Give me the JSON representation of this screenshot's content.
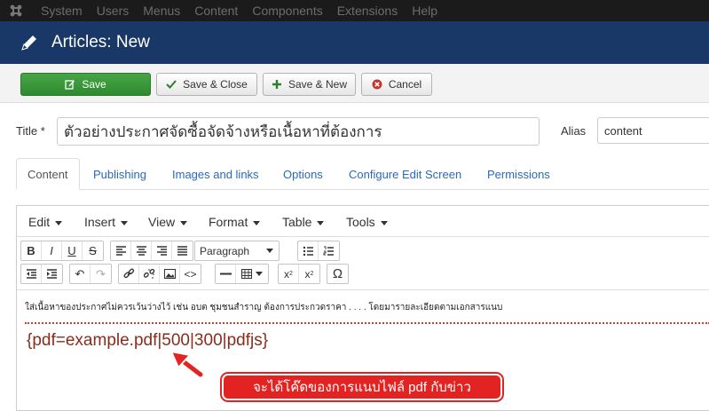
{
  "menubar": {
    "items": [
      "System",
      "Users",
      "Menus",
      "Content",
      "Components",
      "Extensions",
      "Help"
    ]
  },
  "header": {
    "title": "Articles: New"
  },
  "toolbar": {
    "save": "Save",
    "save_close": "Save & Close",
    "save_new": "Save & New",
    "cancel": "Cancel"
  },
  "form": {
    "title_label": "Title *",
    "title_value": "ตัวอย่างประกาศจัดซื้อจัดจ้างหรือเนื้อหาที่ต้องการ",
    "alias_label": "Alias",
    "alias_value": "content"
  },
  "tabs": [
    "Content",
    "Publishing",
    "Images and links",
    "Options",
    "Configure Edit Screen",
    "Permissions"
  ],
  "editor": {
    "menus": [
      "Edit",
      "Insert",
      "View",
      "Format",
      "Table",
      "Tools"
    ],
    "format_select": "Paragraph",
    "body_text": "ใส่เนื้อหาของประกาศไม่ควรเว้นว่างไว้ เช่น อบต ชุมชนสำราญ ต้องการประกวดราคา . . . . โดยมารายละเอียดตามเอกสารแนบ",
    "code_text": "{pdf=example.pdf|500|300|pdfjs}"
  },
  "annotation": {
    "callout_text": "จะได้โค๊ดของการแนบไฟล์ pdf กับข่าว"
  },
  "colors": {
    "header_bg": "#1a3867",
    "save_green": "#3f9b3f",
    "callout_red": "#e32222",
    "link_blue": "#2a69b8"
  }
}
